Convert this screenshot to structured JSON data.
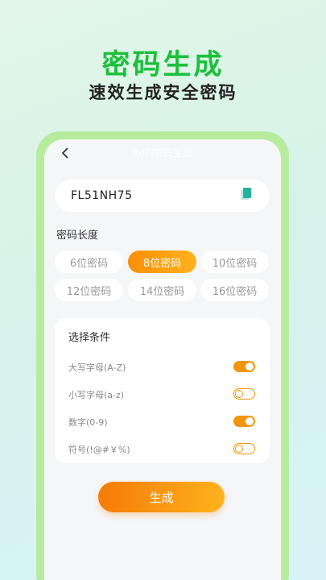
{
  "hero": {
    "title": "密码生成",
    "subtitle": "速效生成安全密码"
  },
  "nav": {
    "title": "WIFI密码生成"
  },
  "password": {
    "value": "FL51NH75"
  },
  "length_section": {
    "label": "密码长度",
    "options": [
      "6位密码",
      "8位密码",
      "10位密码",
      "12位密码",
      "14位密码",
      "16位密码"
    ],
    "selected": "8位密码"
  },
  "conditions": {
    "title": "选择条件",
    "items": [
      {
        "label": "大写字母(A-Z)",
        "enabled": true
      },
      {
        "label": "小写字母(a-z)",
        "enabled": false
      },
      {
        "label": "数字(0-9)",
        "enabled": true
      },
      {
        "label": "符号(!@#￥%)",
        "enabled": false
      }
    ]
  },
  "generate_button": {
    "label": "生成"
  },
  "colors": {
    "hero_green": "#1dbf3c",
    "phone_frame": "#b7ec9f",
    "accent_orange": "#f39508"
  }
}
